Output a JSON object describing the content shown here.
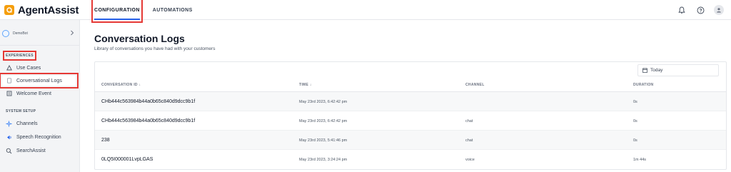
{
  "app": {
    "name": "AgentAssist",
    "brand_color": "#f59e0b"
  },
  "topnav": {
    "tabs": [
      {
        "label": "CONFIGURATION",
        "active": true
      },
      {
        "label": "AUTOMATIONS",
        "active": false
      }
    ],
    "icons": [
      "bell-icon",
      "help-icon",
      "user-icon"
    ]
  },
  "sidebar": {
    "bot": {
      "name": "DemoBot"
    },
    "experiences_label": "EXPERIENCES",
    "experiences": [
      {
        "label": "Use Cases",
        "icon": "use-cases-icon"
      },
      {
        "label": "Conversational Logs",
        "icon": "logs-icon",
        "active": true
      },
      {
        "label": "Welcome Event",
        "icon": "welcome-icon"
      }
    ],
    "system_label": "SYSTEM SETUP",
    "system": [
      {
        "label": "Channels",
        "icon": "channels-icon"
      },
      {
        "label": "Speech Recognition",
        "icon": "speech-icon"
      },
      {
        "label": "SearchAssist",
        "icon": "search-icon"
      }
    ]
  },
  "main": {
    "title": "Conversation Logs",
    "subtitle": "Library of conversations you have had with your customers",
    "date_filter": "Today",
    "columns": [
      "CONVERSATION ID ↓",
      "TIME ↓",
      "CHANNEL",
      "DURATION"
    ],
    "rows": [
      {
        "id": "CHb444c563984b44a0b65c840d9dcc9b1f",
        "time": "May 23rd 2023, 6:42:42 pm",
        "channel": "",
        "duration": "0s"
      },
      {
        "id": "CHb444c563984b44a0b65c840d9dcc9b1f",
        "time": "May 23rd 2023, 6:42:42 pm",
        "channel": "chat",
        "duration": "0s"
      },
      {
        "id": "238",
        "time": "May 23rd 2023, 5:41:46 pm",
        "channel": "chat",
        "duration": "0s"
      },
      {
        "id": "0LQ5I000001LvpLGAS",
        "time": "May 23rd 2023, 3:24:24 pm",
        "channel": "voice",
        "duration": "1m 44s"
      }
    ]
  }
}
